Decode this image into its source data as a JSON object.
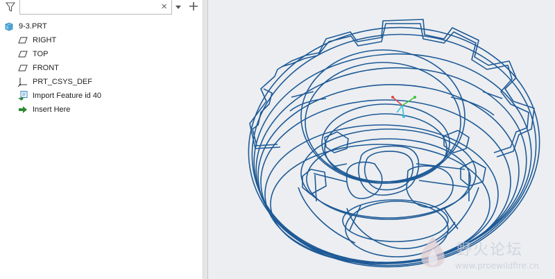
{
  "toolbar": {
    "filter_icon": "filter-funnel",
    "search_value": "",
    "clear_icon": "×",
    "dropdown_icon": "triangle-down",
    "add_icon": "plus"
  },
  "model_tree": {
    "root": {
      "label": "9-3.PRT",
      "icon": "part-cube"
    },
    "items": [
      {
        "label": "RIGHT",
        "icon": "datum-plane"
      },
      {
        "label": "TOP",
        "icon": "datum-plane"
      },
      {
        "label": "FRONT",
        "icon": "datum-plane"
      },
      {
        "label": "PRT_CSYS_DEF",
        "icon": "coordinate-system"
      },
      {
        "label": "Import Feature id 40",
        "icon": "import-feature"
      },
      {
        "label": "Insert Here",
        "icon": "insert-arrow"
      }
    ]
  },
  "viewport": {
    "background": "#eceef1",
    "wire_color": "#1e5a96",
    "display_style": "wireframe"
  },
  "watermark": {
    "text": "野火论坛",
    "url": "www.proewildfire.cn"
  }
}
